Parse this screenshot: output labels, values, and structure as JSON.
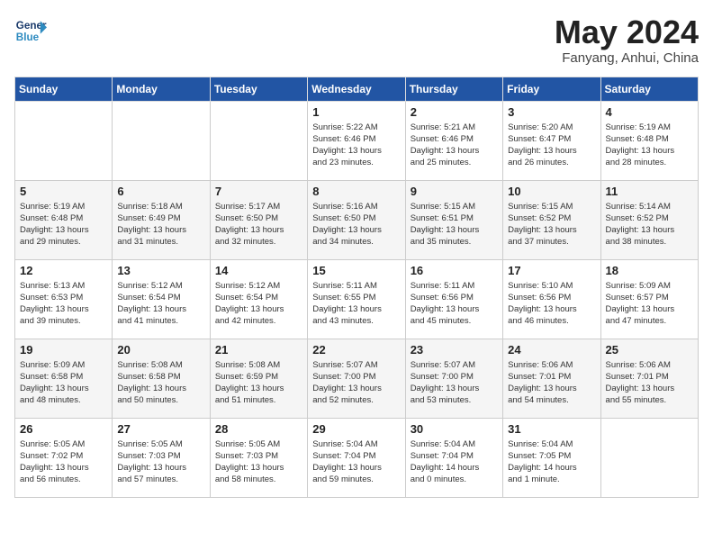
{
  "header": {
    "logo_general": "General",
    "logo_blue": "Blue",
    "month_title": "May 2024",
    "location": "Fanyang, Anhui, China"
  },
  "days_of_week": [
    "Sunday",
    "Monday",
    "Tuesday",
    "Wednesday",
    "Thursday",
    "Friday",
    "Saturday"
  ],
  "weeks": [
    [
      {
        "day": "",
        "info": ""
      },
      {
        "day": "",
        "info": ""
      },
      {
        "day": "",
        "info": ""
      },
      {
        "day": "1",
        "info": "Sunrise: 5:22 AM\nSunset: 6:46 PM\nDaylight: 13 hours\nand 23 minutes."
      },
      {
        "day": "2",
        "info": "Sunrise: 5:21 AM\nSunset: 6:46 PM\nDaylight: 13 hours\nand 25 minutes."
      },
      {
        "day": "3",
        "info": "Sunrise: 5:20 AM\nSunset: 6:47 PM\nDaylight: 13 hours\nand 26 minutes."
      },
      {
        "day": "4",
        "info": "Sunrise: 5:19 AM\nSunset: 6:48 PM\nDaylight: 13 hours\nand 28 minutes."
      }
    ],
    [
      {
        "day": "5",
        "info": "Sunrise: 5:19 AM\nSunset: 6:48 PM\nDaylight: 13 hours\nand 29 minutes."
      },
      {
        "day": "6",
        "info": "Sunrise: 5:18 AM\nSunset: 6:49 PM\nDaylight: 13 hours\nand 31 minutes."
      },
      {
        "day": "7",
        "info": "Sunrise: 5:17 AM\nSunset: 6:50 PM\nDaylight: 13 hours\nand 32 minutes."
      },
      {
        "day": "8",
        "info": "Sunrise: 5:16 AM\nSunset: 6:50 PM\nDaylight: 13 hours\nand 34 minutes."
      },
      {
        "day": "9",
        "info": "Sunrise: 5:15 AM\nSunset: 6:51 PM\nDaylight: 13 hours\nand 35 minutes."
      },
      {
        "day": "10",
        "info": "Sunrise: 5:15 AM\nSunset: 6:52 PM\nDaylight: 13 hours\nand 37 minutes."
      },
      {
        "day": "11",
        "info": "Sunrise: 5:14 AM\nSunset: 6:52 PM\nDaylight: 13 hours\nand 38 minutes."
      }
    ],
    [
      {
        "day": "12",
        "info": "Sunrise: 5:13 AM\nSunset: 6:53 PM\nDaylight: 13 hours\nand 39 minutes."
      },
      {
        "day": "13",
        "info": "Sunrise: 5:12 AM\nSunset: 6:54 PM\nDaylight: 13 hours\nand 41 minutes."
      },
      {
        "day": "14",
        "info": "Sunrise: 5:12 AM\nSunset: 6:54 PM\nDaylight: 13 hours\nand 42 minutes."
      },
      {
        "day": "15",
        "info": "Sunrise: 5:11 AM\nSunset: 6:55 PM\nDaylight: 13 hours\nand 43 minutes."
      },
      {
        "day": "16",
        "info": "Sunrise: 5:11 AM\nSunset: 6:56 PM\nDaylight: 13 hours\nand 45 minutes."
      },
      {
        "day": "17",
        "info": "Sunrise: 5:10 AM\nSunset: 6:56 PM\nDaylight: 13 hours\nand 46 minutes."
      },
      {
        "day": "18",
        "info": "Sunrise: 5:09 AM\nSunset: 6:57 PM\nDaylight: 13 hours\nand 47 minutes."
      }
    ],
    [
      {
        "day": "19",
        "info": "Sunrise: 5:09 AM\nSunset: 6:58 PM\nDaylight: 13 hours\nand 48 minutes."
      },
      {
        "day": "20",
        "info": "Sunrise: 5:08 AM\nSunset: 6:58 PM\nDaylight: 13 hours\nand 50 minutes."
      },
      {
        "day": "21",
        "info": "Sunrise: 5:08 AM\nSunset: 6:59 PM\nDaylight: 13 hours\nand 51 minutes."
      },
      {
        "day": "22",
        "info": "Sunrise: 5:07 AM\nSunset: 7:00 PM\nDaylight: 13 hours\nand 52 minutes."
      },
      {
        "day": "23",
        "info": "Sunrise: 5:07 AM\nSunset: 7:00 PM\nDaylight: 13 hours\nand 53 minutes."
      },
      {
        "day": "24",
        "info": "Sunrise: 5:06 AM\nSunset: 7:01 PM\nDaylight: 13 hours\nand 54 minutes."
      },
      {
        "day": "25",
        "info": "Sunrise: 5:06 AM\nSunset: 7:01 PM\nDaylight: 13 hours\nand 55 minutes."
      }
    ],
    [
      {
        "day": "26",
        "info": "Sunrise: 5:05 AM\nSunset: 7:02 PM\nDaylight: 13 hours\nand 56 minutes."
      },
      {
        "day": "27",
        "info": "Sunrise: 5:05 AM\nSunset: 7:03 PM\nDaylight: 13 hours\nand 57 minutes."
      },
      {
        "day": "28",
        "info": "Sunrise: 5:05 AM\nSunset: 7:03 PM\nDaylight: 13 hours\nand 58 minutes."
      },
      {
        "day": "29",
        "info": "Sunrise: 5:04 AM\nSunset: 7:04 PM\nDaylight: 13 hours\nand 59 minutes."
      },
      {
        "day": "30",
        "info": "Sunrise: 5:04 AM\nSunset: 7:04 PM\nDaylight: 14 hours\nand 0 minutes."
      },
      {
        "day": "31",
        "info": "Sunrise: 5:04 AM\nSunset: 7:05 PM\nDaylight: 14 hours\nand 1 minute."
      },
      {
        "day": "",
        "info": ""
      }
    ]
  ]
}
